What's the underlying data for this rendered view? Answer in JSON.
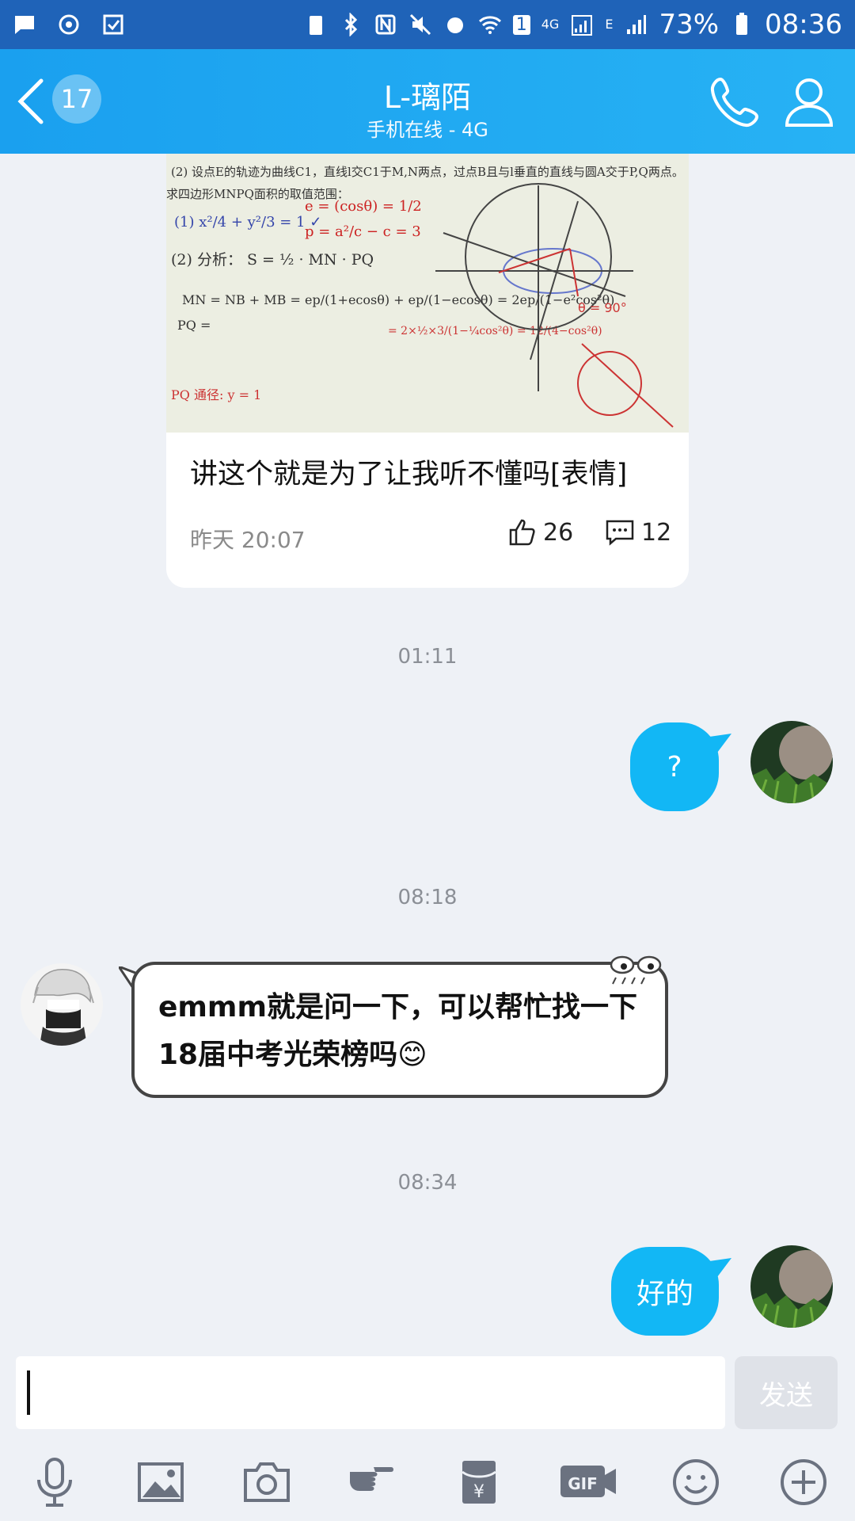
{
  "status_bar": {
    "battery": "73%",
    "time": "08:36",
    "net_4g": "4G",
    "net_e": "E",
    "sim_number": "1"
  },
  "header": {
    "back_count": "17",
    "title": "L-璃陌",
    "subtitle": "手机在线 - 4G"
  },
  "share_card": {
    "caption": "讲这个就是为了让我听不懂吗[表情]",
    "time": "昨天 20:07",
    "likes": "26",
    "comments": "12",
    "image": {
      "line1": "(2) 设点E的轨迹为曲线C1，直线l交C1于M,N两点，过点B且与l垂直的直线与圆A交于P,Q两点。",
      "line2": "求四边形MNPQ面积的取值范围："
    }
  },
  "messages": [
    {
      "timestamp": "01:11",
      "from": "me",
      "text": "?"
    },
    {
      "timestamp": "08:18",
      "from": "other",
      "text": "emmm就是问一下，可以帮忙找一下18届中考光荣榜吗😊"
    },
    {
      "timestamp": "08:34",
      "from": "me",
      "text": "好的"
    }
  ],
  "input": {
    "value": "",
    "send_label": "发送"
  },
  "toolbar": [
    "microphone-icon",
    "image-icon",
    "camera-icon",
    "poke-icon",
    "red-packet-icon",
    "gif-icon",
    "emoji-icon",
    "plus-icon"
  ],
  "colors": {
    "header": "#1aa0ef",
    "status_bar": "#1f63b8",
    "bubble_me": "#12b7f5",
    "background": "#eef1f6"
  }
}
